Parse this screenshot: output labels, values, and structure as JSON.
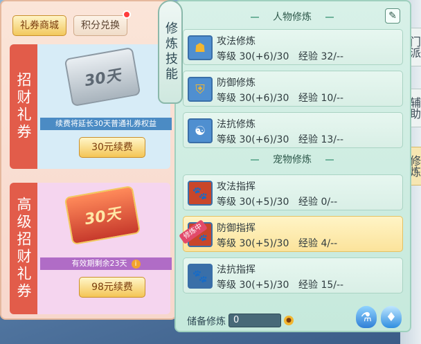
{
  "shop": {
    "tabs": [
      {
        "label": "礼券商城"
      },
      {
        "label": "积分兑换"
      }
    ],
    "cards": [
      {
        "title": "招财礼券",
        "ticket_text": "30天",
        "desc": "续费将延长30天普通礼券权益",
        "button": "30元续费"
      },
      {
        "title": "高级招财礼券",
        "ticket_text": "30天",
        "desc": "有效期剩余23天",
        "button": "98元续费"
      }
    ]
  },
  "cultivation": {
    "banner": "修炼技能",
    "character_section": "人物修炼",
    "pet_section": "宠物修炼",
    "character_skills": [
      {
        "name": "攻法修炼",
        "level": "等级  30(+6)/30",
        "exp": "经验  32/--",
        "icon": "martial-icon"
      },
      {
        "name": "防御修炼",
        "level": "等级  30(+6)/30",
        "exp": "经验  10/--",
        "icon": "shield-icon"
      },
      {
        "name": "法抗修炼",
        "level": "等级  30(+6)/30",
        "exp": "经验  13/--",
        "icon": "yinyang-icon"
      }
    ],
    "pet_skills": [
      {
        "name": "攻法指挥",
        "level": "等级  30(+5)/30",
        "exp": "经验  0/--",
        "icon": "paw-attack-icon"
      },
      {
        "name": "防御指挥",
        "level": "等级  30(+5)/30",
        "exp": "经验  4/--",
        "icon": "paw-defend-icon",
        "ribbon": "修炼中"
      },
      {
        "name": "法抗指挥",
        "level": "等级  30(+5)/30",
        "exp": "经验  15/--",
        "icon": "paw-resist-icon"
      }
    ],
    "store_label": "储备修炼",
    "store_value": "0"
  },
  "side_tabs": [
    {
      "label": "门派"
    },
    {
      "label": "辅助"
    },
    {
      "label": "修炼"
    }
  ],
  "colors": {
    "shop_bg": "#f7d7cc",
    "cult_bg": "#c6e9dc",
    "button_gold": "#f4c555",
    "highlight": "#fbe39b"
  }
}
